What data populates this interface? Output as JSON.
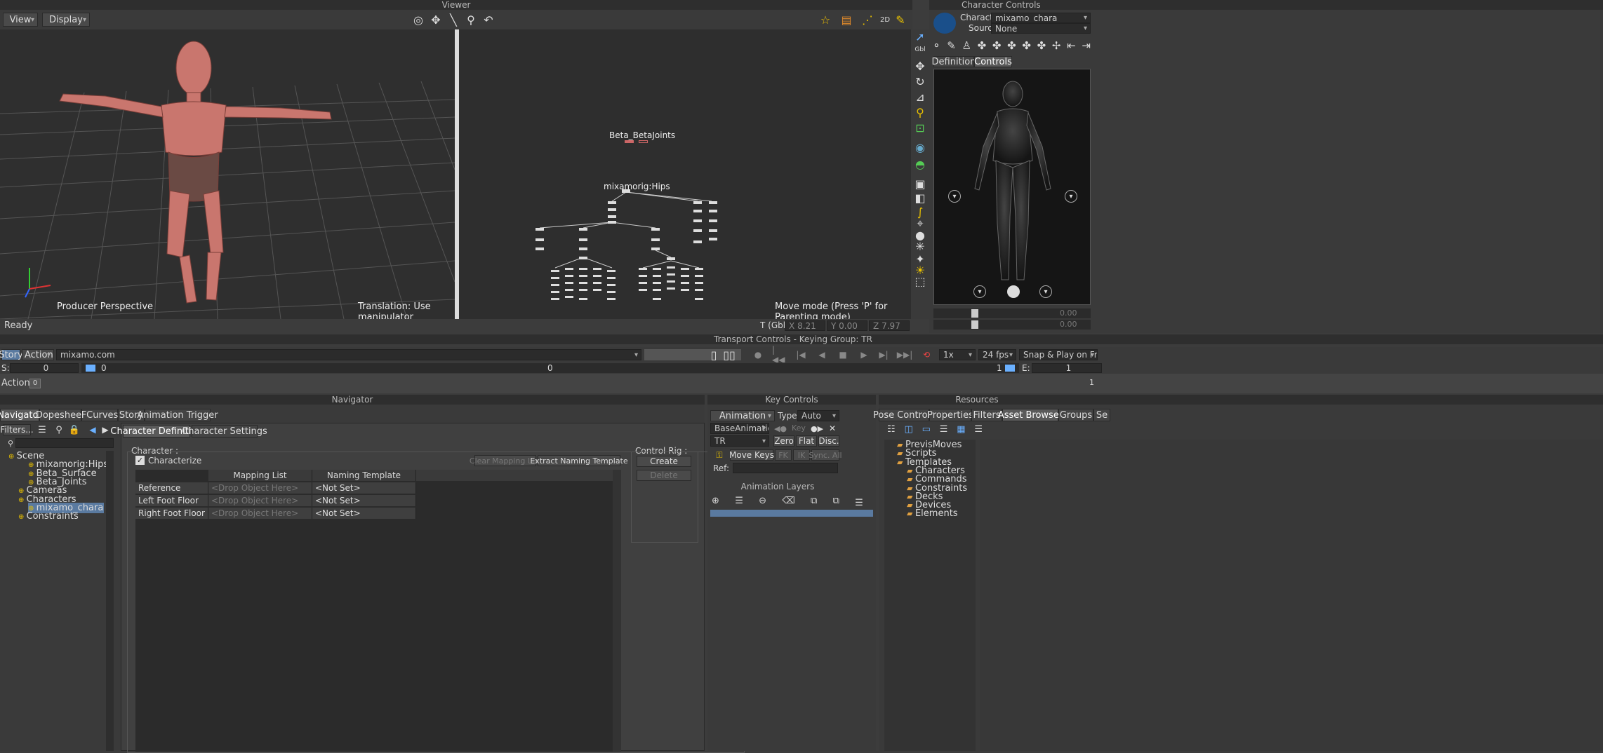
{
  "viewer": {
    "title": "Viewer",
    "menu_view": "View",
    "menu_display": "Display",
    "left_view_label": "Producer Perspective",
    "left_status": "Translation: Use manipulator",
    "right_status": "Move mode (Press 'P' for Parenting mode)",
    "node_beta": "Beta_BetaJoints",
    "node_hips": "mixamorig:Hips",
    "ready": "Ready",
    "coords_label": "T (Gbl)",
    "x_label": "X",
    "x_val": "8.21",
    "y_label": "Y",
    "y_val": "0.00",
    "z_label": "Z",
    "z_val": "7.97"
  },
  "character_controls": {
    "title": "Character Controls",
    "character_label": "Character:",
    "character_value": "mixamo_chara",
    "source_label": "Source:",
    "source_value": "None",
    "tab_definition": "Definition",
    "tab_controls": "Controls",
    "val1": "0.00",
    "val2": "0.00"
  },
  "transport": {
    "title": "Transport Controls  -  Keying Group: TR",
    "story_label": "Story",
    "action_label": "Action",
    "take_value": "mixamo.com",
    "speed": "1x",
    "fps": "24 fps",
    "snap": "Snap & Play on Frames",
    "start_label": "S:",
    "start_value": "0",
    "cur_value": "0",
    "mid_value": "0",
    "end_marker": "1",
    "end_label": "E:",
    "end_value": "1",
    "action_track": "Action",
    "action_frame": "0",
    "track_end": "1"
  },
  "navigator": {
    "title": "Navigator",
    "tabs": [
      "Navigator",
      "Dopesheet",
      "FCurves",
      "Story",
      "Animation Trigger"
    ],
    "filters": "Filters...",
    "tree": [
      {
        "label": "Scene",
        "indent": 0
      },
      {
        "label": "mixamorig:Hips",
        "indent": 2
      },
      {
        "label": "Beta_Surface",
        "indent": 2
      },
      {
        "label": "Beta_Joints",
        "indent": 2
      },
      {
        "label": "Cameras",
        "indent": 1
      },
      {
        "label": "Characters",
        "indent": 1
      },
      {
        "label": "mixamo_chara",
        "indent": 2
      },
      {
        "label": "Constraints",
        "indent": 1
      }
    ],
    "sub_tabs": [
      "Character Definition",
      "Character Settings"
    ],
    "character_group": "Character :",
    "characterize": "Characterize",
    "clear_mapping": "Clear Mapping List",
    "extract_template": "Extract Naming Template",
    "col_mapping": "Mapping List",
    "col_naming": "Naming Template",
    "rows": [
      {
        "name": "Reference",
        "drop": "<Drop Object Here>",
        "template": "<Not Set>"
      },
      {
        "name": "Left Foot Floor",
        "drop": "<Drop Object Here>",
        "template": "<Not Set>"
      },
      {
        "name": "Right Foot Floor",
        "drop": "<Drop Object Here>",
        "template": "<Not Set>"
      }
    ],
    "control_rig": "Control Rig :",
    "create": "Create",
    "delete": "Delete"
  },
  "key_controls": {
    "title": "Key Controls",
    "animation": "Animation",
    "type_label": "Type :",
    "type_value": "Auto",
    "layer_value": "BaseAnimation",
    "key_label": "Key",
    "group_value": "TR",
    "zero": "Zero",
    "flat": "Flat",
    "disc": "Disc.",
    "move_keys": "Move Keys",
    "fk": "FK",
    "ik": "IK",
    "sync_all": "Sync. All",
    "ref_label": "Ref:",
    "anim_layers": "Animation Layers"
  },
  "resources": {
    "title": "Resources",
    "tabs": [
      "Pose Controls",
      "Properties",
      "Filters",
      "Asset Browser",
      "Groups",
      "Se"
    ],
    "tree": [
      {
        "label": "PrevisMoves",
        "indent": 1
      },
      {
        "label": "Scripts",
        "indent": 1
      },
      {
        "label": "Templates",
        "indent": 1
      },
      {
        "label": "Characters",
        "indent": 2
      },
      {
        "label": "Commands",
        "indent": 2
      },
      {
        "label": "Constraints",
        "indent": 2
      },
      {
        "label": "Decks",
        "indent": 2
      },
      {
        "label": "Devices",
        "indent": 2
      },
      {
        "label": "Elements",
        "indent": 2
      }
    ]
  }
}
